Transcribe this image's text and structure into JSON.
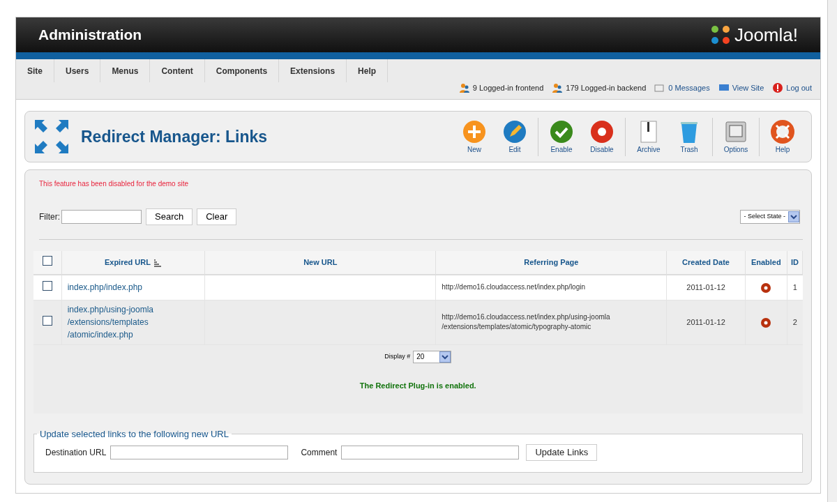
{
  "header": {
    "title": "Administration",
    "logo": "Joomla!"
  },
  "menu": [
    "Site",
    "Users",
    "Menus",
    "Content",
    "Components",
    "Extensions",
    "Help"
  ],
  "status": [
    {
      "kind": "users",
      "text": "9 Logged-in frontend"
    },
    {
      "kind": "users",
      "text": "179 Logged-in backend"
    },
    {
      "kind": "messages",
      "text": "0 Messages"
    },
    {
      "kind": "site",
      "text": "View Site"
    },
    {
      "kind": "logout",
      "text": "Log out"
    }
  ],
  "page_title": "Redirect Manager: Links",
  "toolbar": [
    {
      "kind": "new",
      "label": "New"
    },
    {
      "kind": "edit",
      "label": "Edit"
    },
    {
      "kind": "sep"
    },
    {
      "kind": "enable",
      "label": "Enable"
    },
    {
      "kind": "disable",
      "label": "Disable"
    },
    {
      "kind": "sep"
    },
    {
      "kind": "archive",
      "label": "Archive"
    },
    {
      "kind": "trash",
      "label": "Trash"
    },
    {
      "kind": "sep"
    },
    {
      "kind": "options",
      "label": "Options"
    },
    {
      "kind": "sep"
    },
    {
      "kind": "help",
      "label": "Help"
    }
  ],
  "notice": "This feature has been disabled for the demo site",
  "filter": {
    "label": "Filter:",
    "search": "Search",
    "clear": "Clear",
    "state_select": "- Select State -"
  },
  "table": {
    "select_all_checked": false,
    "columns": [
      "Expired URL",
      "New URL",
      "Referring Page",
      "Created Date",
      "Enabled",
      "ID"
    ],
    "rows": [
      {
        "checked": false,
        "expired": "index.php/index.php",
        "new_url": "",
        "referrer": "http://demo16.cloudaccess.net/index.php/login",
        "date": "2011-01-12",
        "enabled": false,
        "id": "1"
      },
      {
        "checked": false,
        "expired": "index.php/using-joomla /extensions/templates /atomic/index.php",
        "new_url": "",
        "referrer": "http://demo16.cloudaccess.net/index.php/using-joomla /extensions/templates/atomic/typography-atomic",
        "date": "2011-01-12",
        "enabled": false,
        "id": "2"
      }
    ]
  },
  "display": {
    "label": "Display #",
    "value": "20"
  },
  "plugin_status": "The Redirect Plug-in is enabled.",
  "update": {
    "legend": "Update selected links to the following new URL",
    "destination_label": "Destination URL",
    "comment_label": "Comment",
    "button": "Update Links"
  }
}
